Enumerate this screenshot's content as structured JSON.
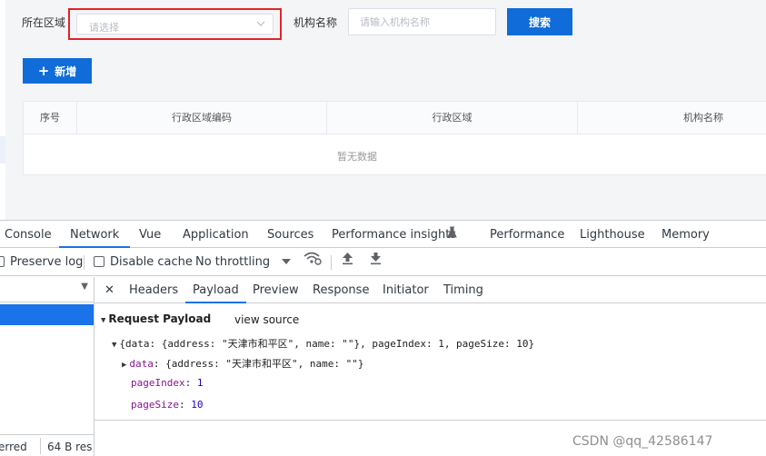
{
  "filter": {
    "region_label": "所在区域",
    "region_placeholder": "请选择",
    "org_label": "机构名称",
    "org_placeholder": "请输入机构名称",
    "search_label": "搜索",
    "add_label": "新增"
  },
  "table": {
    "columns": [
      "序号",
      "行政区域编码",
      "行政区域",
      "机构名称"
    ],
    "empty_text": "暂无数据"
  },
  "devtools": {
    "tabs": [
      "Console",
      "Network",
      "Vue",
      "Application",
      "Sources",
      "Performance insights",
      "Performance",
      "Lighthouse",
      "Memory"
    ],
    "active_tab": "Network",
    "toolbar": {
      "preserve_log": "Preserve log",
      "disable_cache": "Disable cache",
      "throttling": "No throttling"
    },
    "request_tabs": [
      "Headers",
      "Payload",
      "Preview",
      "Response",
      "Initiator",
      "Timing"
    ],
    "active_request_tab": "Payload",
    "status_footer": {
      "left": "erred",
      "right": "64 B res"
    },
    "payload": {
      "title": "Request Payload",
      "view_source": "view source",
      "summary": "{data: {address: \"天津市和平区\", name: \"\"}, pageIndex: 1, pageSize: 10}",
      "data_key": "data",
      "data_value": "{address: \"天津市和平区\", name: \"\"}",
      "page_index_key": "pageIndex",
      "page_index_value": "1",
      "page_size_key": "pageSize",
      "page_size_value": "10"
    }
  },
  "watermark": "CSDN @qq_42586147",
  "colors": {
    "primary": "#0f6cd8",
    "highlight_border": "#e0242a",
    "devtools_accent": "#1a73e8"
  }
}
